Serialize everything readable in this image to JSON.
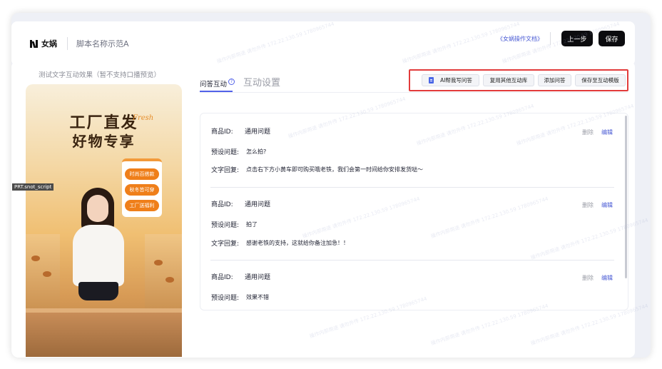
{
  "header": {
    "logo_text": "女娲",
    "script_name": "脚本名称示范A",
    "doc_link": "《女娲操作文档》",
    "prev_button": "上一步",
    "save_button": "保存"
  },
  "preview": {
    "label": "测试文字互动效果（暂不支持口播预览）",
    "poster_title_line1": "工厂直发",
    "poster_title_line2": "好物专享",
    "poster_fresh": "Fresh",
    "tags": [
      "时尚百搭款",
      "秋冬皆可穿",
      "工厂送福利"
    ],
    "overlay_label": "PRT.snot_script"
  },
  "tabs": {
    "qa": "问答互动",
    "qa_help_icon": "?",
    "settings": "互动设置"
  },
  "actions": {
    "ai_write": "AI帮我写问答",
    "reuse": "复用其他互动库",
    "add": "添加问答",
    "save_template": "保存至互动模版"
  },
  "qa_list": {
    "product_id_label": "商品ID:",
    "preset_label": "预设问题:",
    "reply_label": "文字回复:",
    "delete_label": "删除",
    "edit_label": "编辑",
    "items": [
      {
        "product_id": "通用问题",
        "preset": "怎么拍?",
        "reply": "点击右下方小黄车即可购买哦老铁，我们会第一时间给你安排发货哒～"
      },
      {
        "product_id": "通用问题",
        "preset": "拍了",
        "reply": "感谢老铁的支持，这就给你备注加急！！"
      },
      {
        "product_id": "通用问题",
        "preset": "效果不错"
      }
    ]
  },
  "watermark": "操作内部用途 请勿外传 172.22.130.59 1780965744",
  "colors": {
    "accent": "#5262e8",
    "highlight_border": "#e23b3b",
    "dark_button": "#0c0c0f"
  }
}
